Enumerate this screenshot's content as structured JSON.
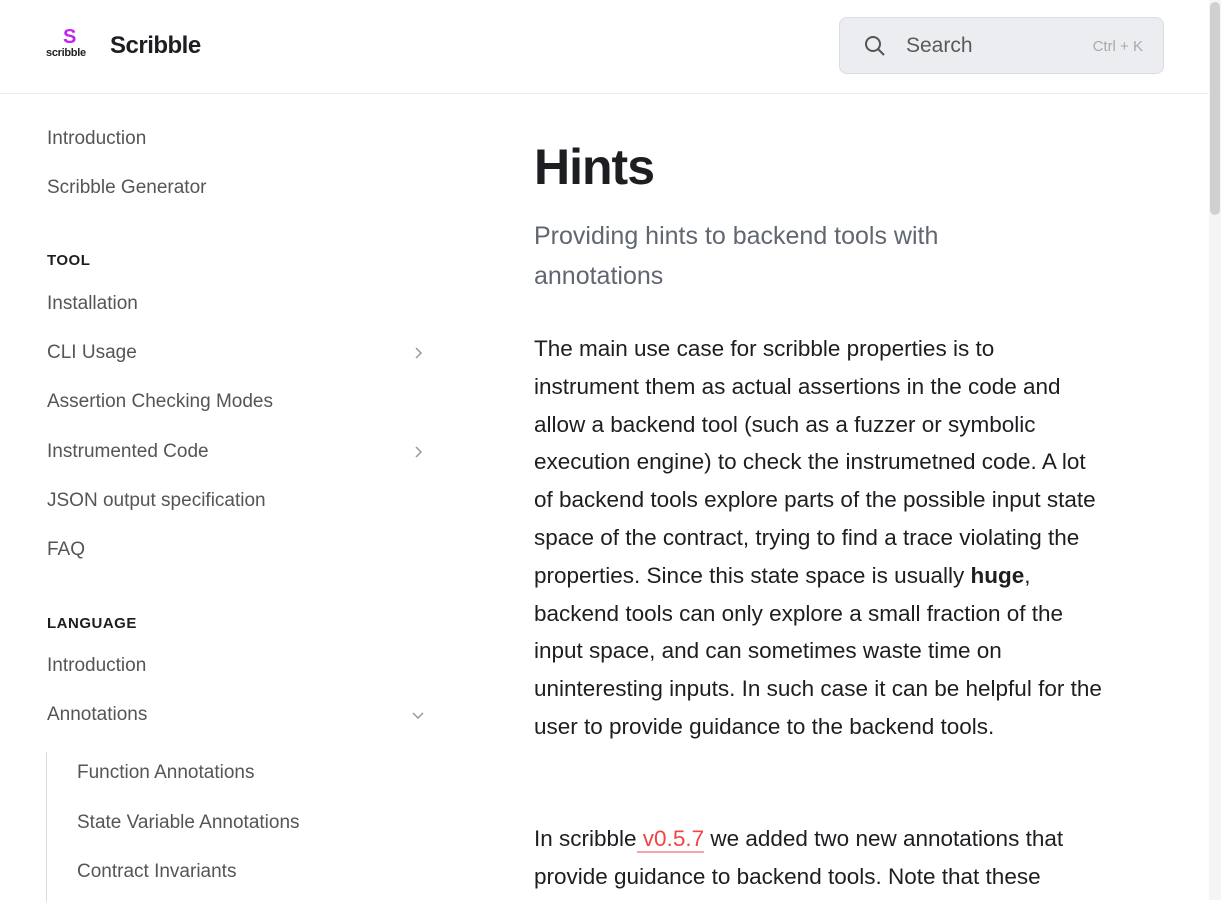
{
  "header": {
    "logo_text": "scribble",
    "brand": "Scribble",
    "search_placeholder": "Search",
    "search_shortcut": "Ctrl + K"
  },
  "sidebar": {
    "top": [
      {
        "label": "Introduction"
      },
      {
        "label": "Scribble Generator"
      }
    ],
    "tool_heading": "TOOL",
    "tool": [
      {
        "label": "Installation"
      },
      {
        "label": "CLI Usage"
      },
      {
        "label": "Assertion Checking Modes"
      },
      {
        "label": "Instrumented Code"
      },
      {
        "label": "JSON output specification"
      },
      {
        "label": "FAQ"
      }
    ],
    "language_heading": "LANGUAGE",
    "language": [
      {
        "label": "Introduction"
      },
      {
        "label": "Annotations"
      }
    ],
    "annotations": [
      {
        "label": "Function Annotations"
      },
      {
        "label": "State Variable Annotations"
      },
      {
        "label": "Contract Invariants"
      }
    ]
  },
  "main": {
    "title": "Hints",
    "subtitle": "Providing hints to backend tools with annotations",
    "p1_a": "The main use case for scribble properties is to instrument them as actual assertions in the code and allow a backend tool (such as a fuzzer or symbolic execution engine) to check the instrumetned code. A lot of backend tools explore parts of the possible input state space of the contract, trying to find a trace violating the properties. Since this state space is usually ",
    "p1_bold": "huge",
    "p1_b": ", backend tools can only explore a small fraction of the input space, and can sometimes waste time on uninteresting inputs. In such case it can be helpful for the user to provide guidance to the backend tools.",
    "p2_a": "In scribble",
    "p2_link": " v0.5.7",
    "p2_b": " we added two new annotations that provide guidance to backend tools. Note that these"
  }
}
